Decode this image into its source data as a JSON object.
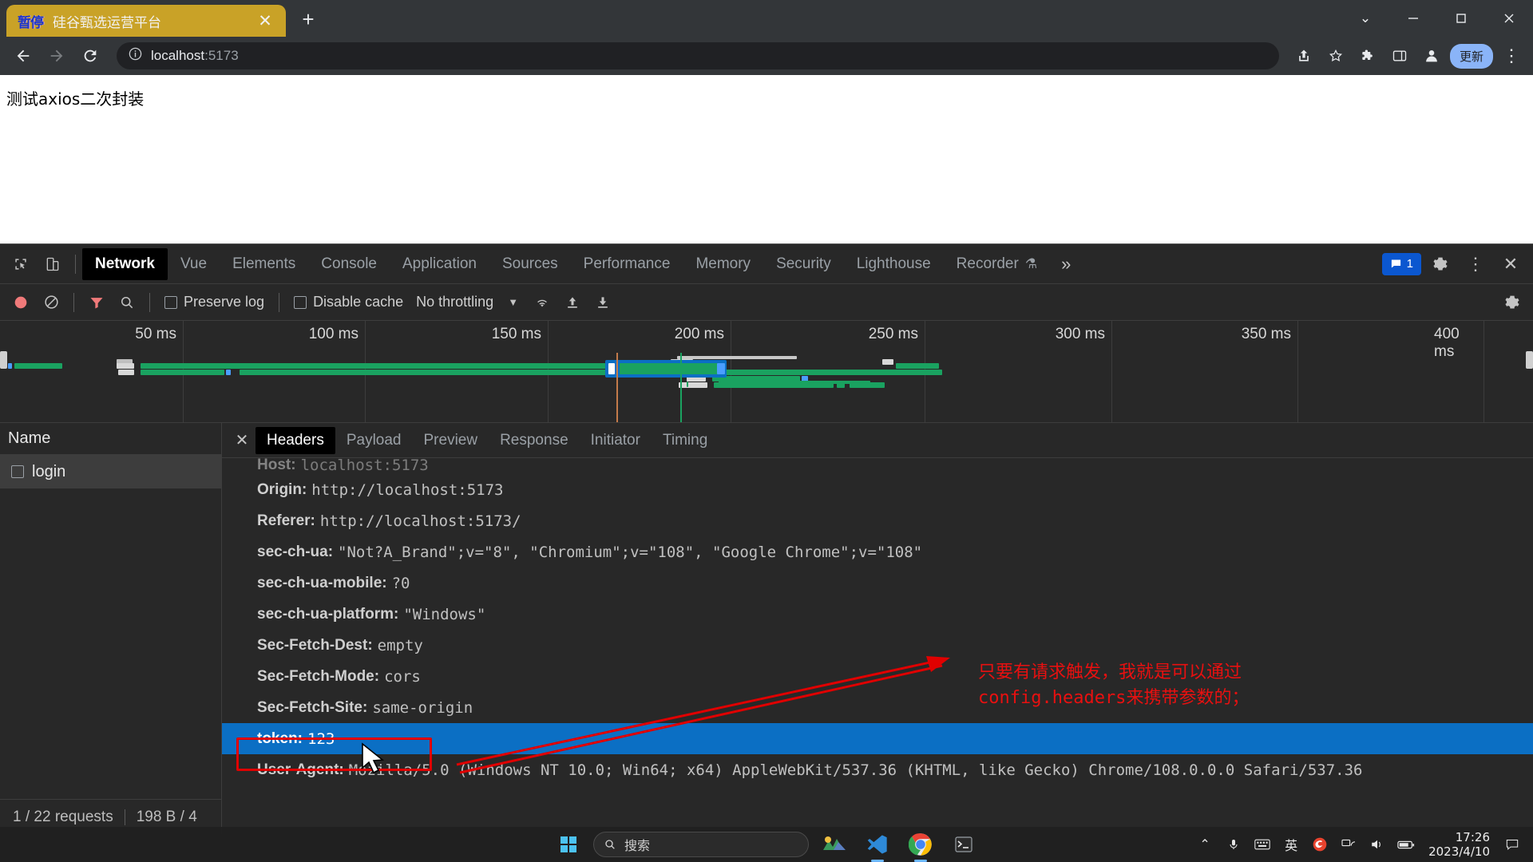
{
  "browser": {
    "tab": {
      "favicon_text": "暂停",
      "title": "硅谷甄选运营平台",
      "close_label": "✕",
      "new_tab_label": "+"
    },
    "window_controls": {
      "minimize": "—",
      "maximize": "▢",
      "close": "✕",
      "tab_search": "⌄"
    },
    "toolbar": {
      "back": "←",
      "forward": "→",
      "reload": "⟳",
      "site_info": "ⓘ",
      "url_host": "localhost",
      "url_rest": ":5173",
      "share_icon": "share-icon",
      "bookmark_icon": "star-icon",
      "extensions_icon": "puzzle-icon",
      "sidepanel_icon": "sidepanel-icon",
      "profile_icon": "profile-icon",
      "update_label": "更新",
      "menu_label": "⋮"
    }
  },
  "page": {
    "text": "测试axios二次封装"
  },
  "devtools": {
    "tabs": [
      {
        "label": "Network",
        "active": true
      },
      {
        "label": "Vue",
        "active": false
      },
      {
        "label": "Elements",
        "active": false
      },
      {
        "label": "Console",
        "active": false
      },
      {
        "label": "Application",
        "active": false
      },
      {
        "label": "Sources",
        "active": false
      },
      {
        "label": "Performance",
        "active": false
      },
      {
        "label": "Memory",
        "active": false
      },
      {
        "label": "Security",
        "active": false
      },
      {
        "label": "Lighthouse",
        "active": false
      },
      {
        "label": "Recorder",
        "active": false,
        "flask": "⚗"
      }
    ],
    "more_label": "»",
    "message_count": "1",
    "settings_icon": "gear-icon",
    "kebab_icon": "⋮",
    "close_icon": "✕",
    "toolbar": {
      "record_icon": "record-circle-icon",
      "clear_icon": "clear-icon",
      "filter_icon": "filter-funnel-icon",
      "search_icon": "search-icon",
      "preserve_log_label": "Preserve log",
      "preserve_log_checked": false,
      "disable_cache_label": "Disable cache",
      "disable_cache_checked": false,
      "throttling_label": "No throttling",
      "throttle_caret": "▼",
      "wifi_icon": "wifi-settings-icon",
      "upload_icon": "import-har-icon",
      "download_icon": "export-har-icon",
      "settings_icon": "gear-icon"
    },
    "overview": {
      "ticks": [
        "50 ms",
        "100 ms",
        "150 ms",
        "200 ms",
        "250 ms",
        "300 ms",
        "350 ms",
        "400 ms"
      ]
    },
    "request_list": {
      "column_header": "Name",
      "rows": [
        {
          "name": "login",
          "selected": true
        }
      ],
      "status_requests": "1 / 22 requests",
      "status_size": "198 B / 4"
    },
    "detail": {
      "close_label": "✕",
      "tabs": [
        {
          "label": "Headers",
          "active": true
        },
        {
          "label": "Payload",
          "active": false
        },
        {
          "label": "Preview",
          "active": false
        },
        {
          "label": "Response",
          "active": false
        },
        {
          "label": "Initiator",
          "active": false
        },
        {
          "label": "Timing",
          "active": false
        }
      ],
      "headers": [
        {
          "key": "Host:",
          "value": "localhost:5173",
          "clipped": true,
          "selected": false
        },
        {
          "key": "Origin:",
          "value": "http://localhost:5173",
          "selected": false
        },
        {
          "key": "Referer:",
          "value": "http://localhost:5173/",
          "selected": false
        },
        {
          "key": "sec-ch-ua:",
          "value": "\"Not?A_Brand\";v=\"8\", \"Chromium\";v=\"108\", \"Google Chrome\";v=\"108\"",
          "selected": false
        },
        {
          "key": "sec-ch-ua-mobile:",
          "value": "?0",
          "selected": false
        },
        {
          "key": "sec-ch-ua-platform:",
          "value": "\"Windows\"",
          "selected": false
        },
        {
          "key": "Sec-Fetch-Dest:",
          "value": "empty",
          "selected": false
        },
        {
          "key": "Sec-Fetch-Mode:",
          "value": "cors",
          "selected": false
        },
        {
          "key": "Sec-Fetch-Site:",
          "value": "same-origin",
          "selected": false
        },
        {
          "key": "token:",
          "value": "123",
          "selected": true
        },
        {
          "key": "User-Agent:",
          "value": "Mozilla/5.0 (Windows NT 10.0; Win64; x64) AppleWebKit/537.36 (KHTML, like Gecko) Chrome/108.0.0.0 Safari/537.36",
          "selected": false
        }
      ]
    }
  },
  "annotation": {
    "line1": "只要有请求触发，我就是可以通过",
    "line2_mono": "config.headers",
    "line2_rest": "来携带参数的；",
    "color": "#e81010"
  },
  "taskbar": {
    "start_label": "start-windows-icon",
    "search_placeholder": "搜索",
    "apps": [
      {
        "name": "weather-widget",
        "glyph": "⛅"
      },
      {
        "name": "vscode",
        "glyph": "VS"
      },
      {
        "name": "chrome",
        "glyph": "◉"
      },
      {
        "name": "terminal",
        "glyph": "▣"
      }
    ],
    "tray": {
      "chevron": "⌃",
      "mic": "🎤",
      "keyboard": "⌨",
      "ime": "英",
      "sogou": "S",
      "network": "📶",
      "volume": "🔊",
      "battery": "🔋",
      "time": "17:26",
      "date": "2023/4/10",
      "notify": "🗨"
    }
  }
}
